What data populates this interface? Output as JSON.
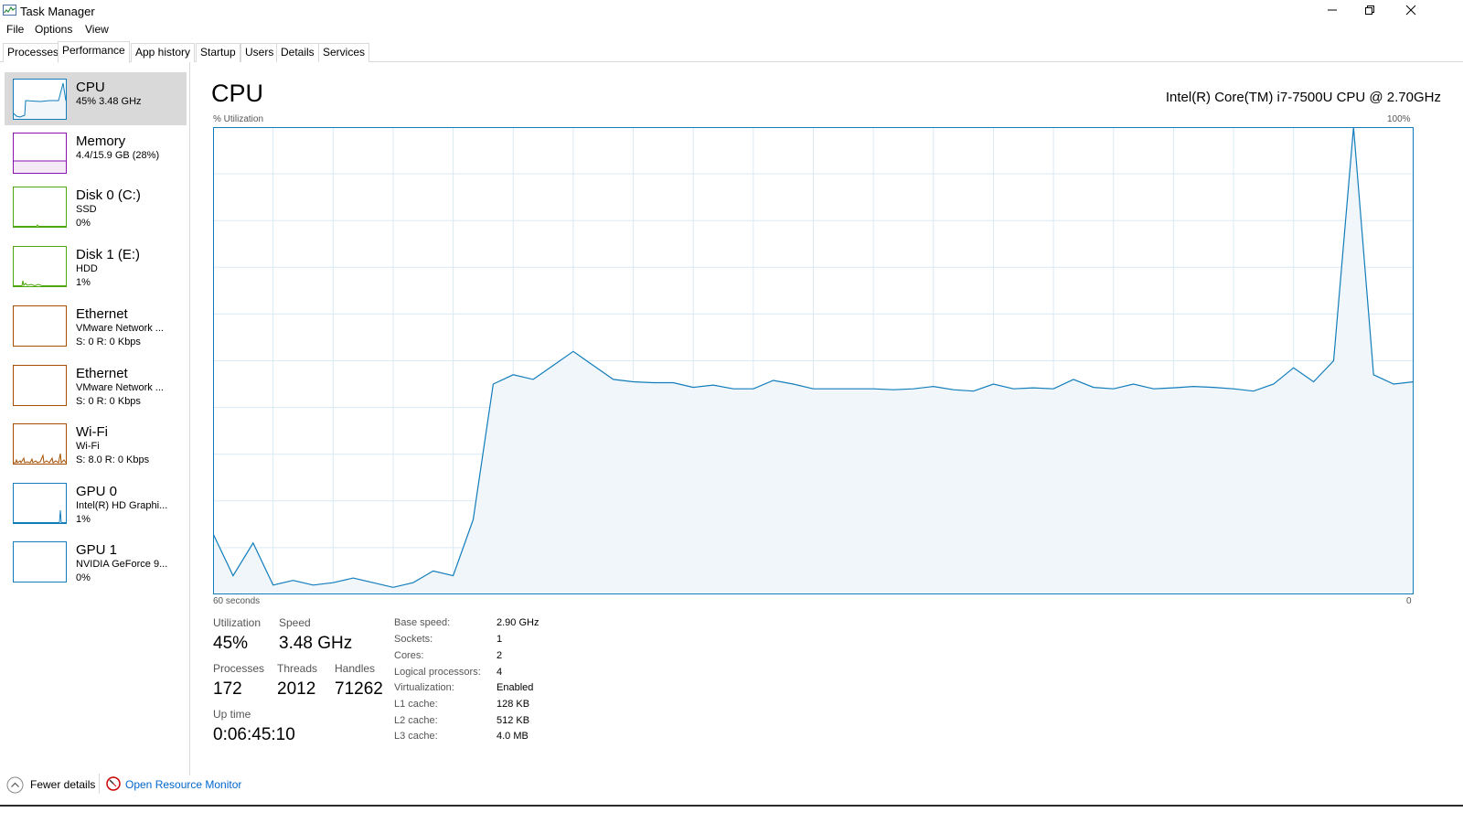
{
  "window": {
    "title": "Task Manager",
    "icons": {
      "app": "task-manager-icon",
      "minimize": "minimize-icon",
      "restore": "restore-icon",
      "close": "close-icon"
    }
  },
  "menu": [
    "File",
    "Options",
    "View"
  ],
  "tabs": [
    "Processes",
    "Performance",
    "App history",
    "Startup",
    "Users",
    "Details",
    "Services"
  ],
  "active_tab": "Performance",
  "sidebar": [
    {
      "title": "CPU",
      "lines": [
        "45% 3.48 GHz"
      ],
      "color": "#117dbb",
      "selected": true
    },
    {
      "title": "Memory",
      "lines": [
        "4.4/15.9 GB (28%)"
      ],
      "color": "#8b12ae",
      "selected": false
    },
    {
      "title": "Disk 0 (C:)",
      "lines": [
        "SSD",
        "0%"
      ],
      "color": "#4da60c",
      "selected": false
    },
    {
      "title": "Disk 1 (E:)",
      "lines": [
        "HDD",
        "1%"
      ],
      "color": "#4da60c",
      "selected": false
    },
    {
      "title": "Ethernet",
      "lines": [
        "VMware Network ...",
        "S: 0 R: 0 Kbps"
      ],
      "color": "#a74f01",
      "selected": false
    },
    {
      "title": "Ethernet",
      "lines": [
        "VMware Network ...",
        "S: 0 R: 0 Kbps"
      ],
      "color": "#a74f01",
      "selected": false
    },
    {
      "title": "Wi-Fi",
      "lines": [
        "Wi-Fi",
        "S: 8.0 R: 0 Kbps"
      ],
      "color": "#a74f01",
      "selected": false
    },
    {
      "title": "GPU 0",
      "lines": [
        "Intel(R) HD Graphi...",
        "1%"
      ],
      "color": "#117dbb",
      "selected": false
    },
    {
      "title": "GPU 1",
      "lines": [
        "NVIDIA GeForce 9...",
        "0%"
      ],
      "color": "#117dbb",
      "selected": false
    }
  ],
  "cpu": {
    "title": "CPU",
    "model": "Intel(R) Core(TM) i7-7500U CPU @ 2.70GHz",
    "graph_label": "% Utilization",
    "graph_max": "100%",
    "graph_left": "60 seconds",
    "graph_right": "0",
    "stats": {
      "utilization_label": "Utilization",
      "utilization": "45%",
      "speed_label": "Speed",
      "speed": "3.48 GHz",
      "processes_label": "Processes",
      "processes": "172",
      "threads_label": "Threads",
      "threads": "2012",
      "handles_label": "Handles",
      "handles": "71262",
      "uptime_label": "Up time",
      "uptime": "0:06:45:10"
    },
    "details": [
      {
        "k": "Base speed:",
        "v": "2.90 GHz"
      },
      {
        "k": "Sockets:",
        "v": "1"
      },
      {
        "k": "Cores:",
        "v": "2"
      },
      {
        "k": "Logical processors:",
        "v": "4"
      },
      {
        "k": "Virtualization:",
        "v": "Enabled"
      },
      {
        "k": "L1 cache:",
        "v": "128 KB"
      },
      {
        "k": "L2 cache:",
        "v": "512 KB"
      },
      {
        "k": "L3 cache:",
        "v": "4.0 MB"
      }
    ]
  },
  "chart_data": {
    "type": "area",
    "ylabel": "% Utilization",
    "ylim": [
      0,
      100
    ],
    "xlabel": "60 seconds",
    "grid": true,
    "color": "#117dbb",
    "series": [
      {
        "values": [
          13,
          4,
          11,
          2,
          3,
          2,
          2.5,
          3.5,
          2.5,
          1.5,
          2.5,
          5,
          4,
          16,
          45,
          47,
          46,
          49,
          52,
          49,
          46,
          45.5,
          45.3,
          45.3,
          44.3,
          44.8,
          44,
          44,
          45.8,
          45,
          44,
          44,
          44,
          44,
          43.8,
          44,
          44.5,
          43.8,
          43.5,
          45,
          44,
          44.2,
          44,
          46,
          44.3,
          44,
          45,
          44,
          44.2,
          44.5,
          44.3,
          44,
          43.5,
          45,
          48.5,
          45.5,
          50,
          100,
          47,
          45,
          45.5
        ]
      }
    ]
  },
  "footer": {
    "fewer_details": "Fewer details",
    "open_resource_monitor": "Open Resource Monitor",
    "icons": {
      "fewer": "chevron-up-icon",
      "resmon": "resource-monitor-icon"
    }
  }
}
